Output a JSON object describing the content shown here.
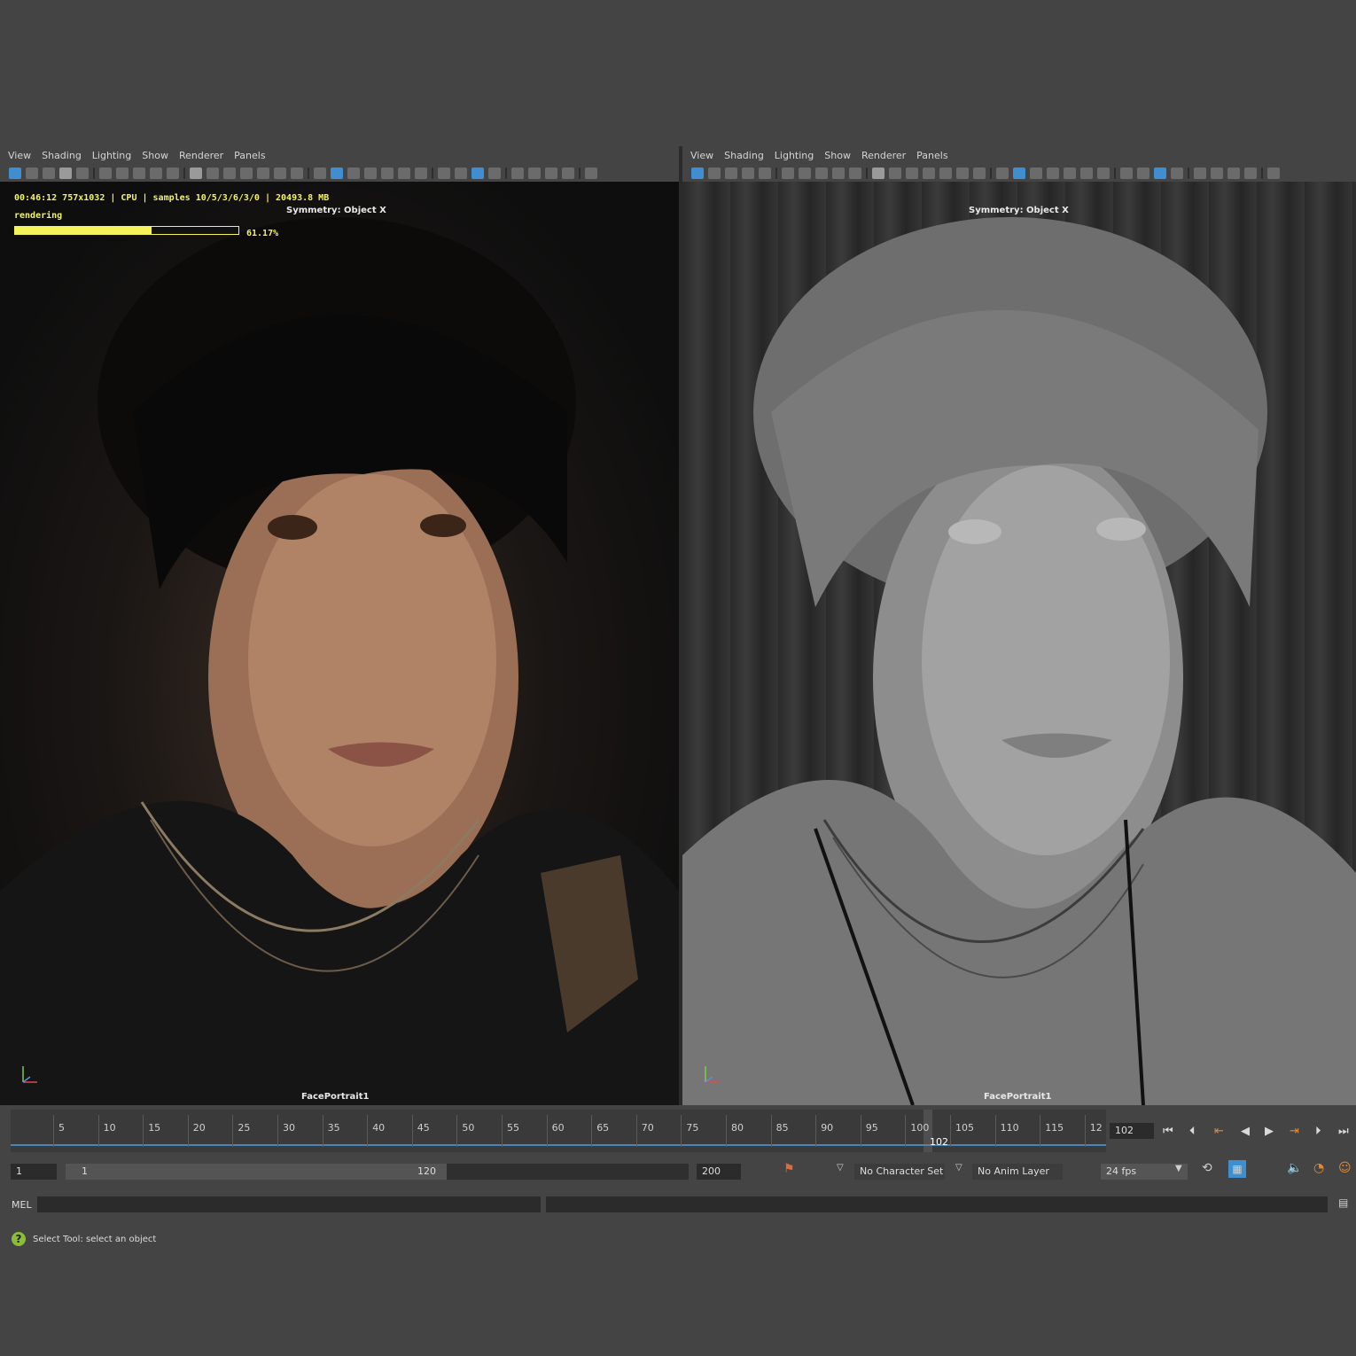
{
  "left_panel": {
    "menu": [
      "View",
      "Shading",
      "Lighting",
      "Show",
      "Renderer",
      "Panels"
    ],
    "hud": {
      "line1": "00:46:12 757x1032 | CPU | samples 10/5/3/6/3/0 | 20493.8 MB",
      "status": "rendering",
      "progress_text": "61.17%",
      "progress_value": 0.6117
    },
    "symmetry": "Symmetry: Object X",
    "camera": "FacePortrait1"
  },
  "right_panel": {
    "menu": [
      "View",
      "Shading",
      "Lighting",
      "Show",
      "Renderer",
      "Panels"
    ],
    "symmetry": "Symmetry: Object X",
    "camera": "FacePortrait1"
  },
  "timeline": {
    "ticks": [
      "5",
      "10",
      "15",
      "20",
      "25",
      "30",
      "35",
      "40",
      "45",
      "50",
      "55",
      "60",
      "65",
      "70",
      "75",
      "80",
      "85",
      "90",
      "95",
      "100",
      "105",
      "110",
      "115",
      "12"
    ],
    "current_frame_label": "102",
    "current_frame_field": "102"
  },
  "range": {
    "start_field": "1",
    "range_start": "1",
    "range_end": "120",
    "end_field": "200",
    "character_set": "No Character Set",
    "anim_layer": "No Anim Layer",
    "fps": "24 fps"
  },
  "command_line": {
    "label": "MEL"
  },
  "status_line": {
    "text": "Select Tool: select an object"
  },
  "colors": {
    "hud_yellow": "#f4f45a",
    "accent_blue": "#4a86b4",
    "help_green": "#8bbd3a"
  },
  "icons": [
    "camera-icon",
    "grid-icon",
    "wireframe-icon",
    "shaded-icon",
    "light-icon",
    "playback-icons",
    "help-icon",
    "sound-icon",
    "loop-icon"
  ]
}
